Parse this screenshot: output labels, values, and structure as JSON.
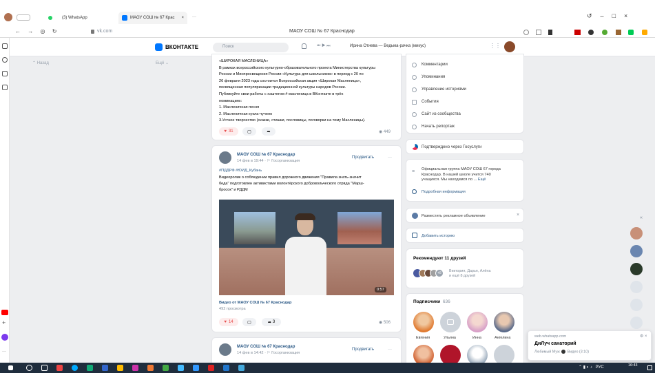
{
  "browser": {
    "tabs": [
      {
        "label": "(3) WhatsApp"
      },
      {
        "label": "МАОУ СОШ № 67 Крас"
      }
    ],
    "close_tab": "×",
    "new_tab": "···",
    "address": "vk.com",
    "page_title": "МАОУ СОШ № 67 Краснодар"
  },
  "vk": {
    "logo_text": "ВКОНТАКТЕ",
    "search_placeholder": "Поиск",
    "player_track": "Ирина Отиева — Ведьма-рачка (микус)",
    "left_back": "Назад",
    "left_more": "Ещё"
  },
  "post1": {
    "lines": [
      "«ШИРОКАЯ МАСЛЕНИЦА»",
      "В рамках всероссийского культурно-образовательного проекта Министерства культуры",
      "России и Минпросвещения России «Культура для школьников» в период с 20 по",
      "26 февраля 2023 года состоится Всероссийская акция «Широкая Масленица»,",
      "посвященная популяризации традиционной культуры народов России.",
      "Публикуйте свои работы с хэштегом # масленица в ВКонтакте в трёх",
      "номинациях:",
      "1. Масленичная песня",
      "2. Масленичная кукла-чучело",
      "3.Устное творчество (сказки, стишки, пословицы, поговорки на тему Масленицы)."
    ],
    "likes": "31",
    "views": "449"
  },
  "post2": {
    "author": "МАОУ СОШ № 67 Краснодар",
    "date": "14 фев в 19:44",
    "geo": "Госорганизация",
    "promote": "Продвигать",
    "more": "···",
    "hashtags": "#ПДДРФ #ЮИД_Кубань",
    "text_line1": "Видеоролик о соблюдении правил дорожного движения \"Правила знать-значит",
    "text_line2": "беда\" подготовлен активистами волонтёрского добровольческого отряда \"Марш-",
    "text_line3": "бросок\" и РДДМ",
    "video_title": "Видео от МАОУ СОШ № 67 Краснодар",
    "video_views": "492 просмотра",
    "duration": "0:57",
    "likes": "14",
    "reposts": "3",
    "views": "506"
  },
  "post3": {
    "author": "МАОУ СОШ № 67 Краснодар",
    "date": "14 фев в 14:42",
    "geo": "Госорганизация",
    "promote": "Продвигать",
    "more": "···"
  },
  "right": {
    "menu": [
      {
        "label": "Комментарии",
        "icon": "comment-icon"
      },
      {
        "label": "Упоминания",
        "icon": "at-icon"
      },
      {
        "label": "Управление историями",
        "icon": "stories-icon"
      },
      {
        "label": "События",
        "icon": "calendar-icon"
      },
      {
        "label": "Сайт из сообщества",
        "icon": "globe-icon"
      },
      {
        "label": "Начать репортаж",
        "icon": "broadcast-icon"
      }
    ],
    "gosuslugi": "Подтверждено через Госуслуги",
    "info_text1": "Официальная группа МАОУ СОШ 67 города",
    "info_text2": "Краснодар. В нашей школе учится 740",
    "info_text3": "учащихся. Мы находимся по ...",
    "info_more": "Ещё",
    "info_details": "Подробная информация",
    "ad": "Разместить рекламное объявление",
    "add_story": "Добавить историю",
    "recommend_title": "Рекомендуют 11 друзей",
    "recommend_plus": "+8",
    "recommend_names": "Виктория, Дарья, Алёна",
    "recommend_more": "и ещё 8 друзей",
    "subscribers_title": "Подписчики",
    "subscribers_count": "636",
    "subscribers": [
      "Евгения",
      "Ульяна",
      "Инна",
      "Ангелина"
    ]
  },
  "notification": {
    "source": "web.whatsapp.com",
    "title": "ДиЛуч санаторий",
    "subtitle": "Любимый Муж",
    "extra": "Видео (3:10)"
  },
  "taskbar": {
    "lang": "РУС",
    "time": "16:43"
  },
  "colors": {
    "vk_blue": "#0077ff",
    "like_red": "#e64646",
    "link": "#2a5885"
  }
}
